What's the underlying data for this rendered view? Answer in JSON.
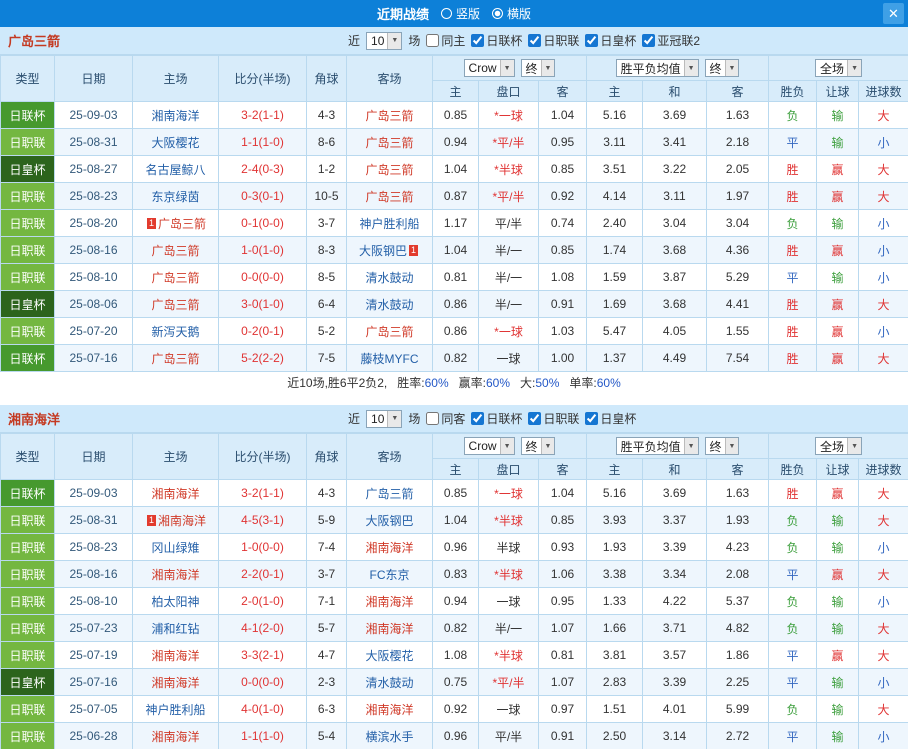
{
  "header": {
    "title": "近期战绩",
    "close_glyph": "✕",
    "layout_options": [
      {
        "label": "竖版",
        "selected": false
      },
      {
        "label": "横版",
        "selected": true
      }
    ]
  },
  "filter_labels": {
    "near": "近",
    "count": "10",
    "games": "场"
  },
  "table_header": {
    "cols": [
      "类型",
      "日期",
      "主场",
      "比分(半场)",
      "角球",
      "客场"
    ],
    "odds_group1": {
      "select1": "Crow",
      "select2": "终",
      "subcols": [
        "主",
        "盘口",
        "客"
      ]
    },
    "odds_group2": {
      "select1": "胜平负均值",
      "select2": "终",
      "subcols": [
        "主",
        "和",
        "客"
      ]
    },
    "result_group": {
      "select1": "全场",
      "subcols": [
        "胜负",
        "让球",
        "进球数"
      ]
    }
  },
  "sections": [
    {
      "team": "广岛三箭",
      "same_label": "同主",
      "same_checked": false,
      "leagues": [
        {
          "label": "日联杯",
          "checked": true
        },
        {
          "label": "日职联",
          "checked": true
        },
        {
          "label": "日皇杯",
          "checked": true
        },
        {
          "label": "亚冠联2",
          "checked": true
        }
      ],
      "rows": [
        {
          "type": "日联杯",
          "date": "25-09-03",
          "home": "湘南海洋",
          "score": "3-2(1-1)",
          "corner": "4-3",
          "away": "广岛三箭",
          "ah": [
            "0.85",
            "*一球",
            "1.04"
          ],
          "eu": [
            "5.16",
            "3.69",
            "1.63"
          ],
          "res": [
            "负",
            "输",
            "大"
          ]
        },
        {
          "type": "日职联",
          "date": "25-08-31",
          "home": "大阪樱花",
          "score": "1-1(1-0)",
          "corner": "8-6",
          "away": "广岛三箭",
          "ah": [
            "0.94",
            "*平/半",
            "0.95"
          ],
          "eu": [
            "3.11",
            "3.41",
            "2.18"
          ],
          "res": [
            "平",
            "输",
            "小"
          ]
        },
        {
          "type": "日皇杯",
          "date": "25-08-27",
          "home": "名古屋鲸八",
          "score": "2-4(0-3)",
          "corner": "1-2",
          "away": "广岛三箭",
          "ah": [
            "1.04",
            "*半球",
            "0.85"
          ],
          "eu": [
            "3.51",
            "3.22",
            "2.05"
          ],
          "res": [
            "胜",
            "赢",
            "大"
          ]
        },
        {
          "type": "日职联",
          "date": "25-08-23",
          "home": "东京绿茵",
          "score": "0-3(0-1)",
          "corner": "10-5",
          "away": "广岛三箭",
          "ah": [
            "0.87",
            "*平/半",
            "0.92"
          ],
          "eu": [
            "4.14",
            "3.11",
            "1.97"
          ],
          "res": [
            "胜",
            "赢",
            "大"
          ]
        },
        {
          "type": "日职联",
          "date": "25-08-20",
          "home": "广岛三箭",
          "home_badge": "1",
          "score": "0-1(0-0)",
          "corner": "3-7",
          "away": "神户胜利船",
          "ah": [
            "1.17",
            "平/半",
            "0.74"
          ],
          "eu": [
            "2.40",
            "3.04",
            "3.04"
          ],
          "res": [
            "负",
            "输",
            "小"
          ]
        },
        {
          "type": "日职联",
          "date": "25-08-16",
          "home": "广岛三箭",
          "score": "1-0(1-0)",
          "corner": "8-3",
          "away": "大阪钢巴",
          "away_badge": "1",
          "ah": [
            "1.04",
            "半/一",
            "0.85"
          ],
          "eu": [
            "1.74",
            "3.68",
            "4.36"
          ],
          "res": [
            "胜",
            "赢",
            "小"
          ]
        },
        {
          "type": "日职联",
          "date": "25-08-10",
          "home": "广岛三箭",
          "score": "0-0(0-0)",
          "corner": "8-5",
          "away": "清水鼓动",
          "ah": [
            "0.81",
            "半/一",
            "1.08"
          ],
          "eu": [
            "1.59",
            "3.87",
            "5.29"
          ],
          "res": [
            "平",
            "输",
            "小"
          ]
        },
        {
          "type": "日皇杯",
          "date": "25-08-06",
          "home": "广岛三箭",
          "score": "3-0(1-0)",
          "corner": "6-4",
          "away": "清水鼓动",
          "ah": [
            "0.86",
            "半/一",
            "0.91"
          ],
          "eu": [
            "1.69",
            "3.68",
            "4.41"
          ],
          "res": [
            "胜",
            "赢",
            "大"
          ]
        },
        {
          "type": "日职联",
          "date": "25-07-20",
          "home": "新泻天鹅",
          "score": "0-2(0-1)",
          "corner": "5-2",
          "away": "广岛三箭",
          "ah": [
            "0.86",
            "*一球",
            "1.03"
          ],
          "eu": [
            "5.47",
            "4.05",
            "1.55"
          ],
          "res": [
            "胜",
            "赢",
            "小"
          ]
        },
        {
          "type": "日联杯",
          "date": "25-07-16",
          "home": "广岛三箭",
          "score": "5-2(2-2)",
          "corner": "7-5",
          "away": "藤枝MYFC",
          "ah": [
            "0.82",
            "一球",
            "1.00"
          ],
          "eu": [
            "1.37",
            "4.49",
            "7.54"
          ],
          "res": [
            "胜",
            "赢",
            "大"
          ]
        }
      ],
      "summary": {
        "prefix": "近10场,胜6平2负2,",
        "stats": [
          {
            "label": "胜率:",
            "value": "60%"
          },
          {
            "label": "赢率:",
            "value": "60%"
          },
          {
            "label": "大:",
            "value": "50%"
          },
          {
            "label": "单率:",
            "value": "60%"
          }
        ]
      }
    },
    {
      "team": "湘南海洋",
      "same_label": "同客",
      "same_checked": false,
      "leagues": [
        {
          "label": "日联杯",
          "checked": true
        },
        {
          "label": "日职联",
          "checked": true
        },
        {
          "label": "日皇杯",
          "checked": true
        }
      ],
      "rows": [
        {
          "type": "日联杯",
          "date": "25-09-03",
          "home": "湘南海洋",
          "score": "3-2(1-1)",
          "corner": "4-3",
          "away": "广岛三箭",
          "ah": [
            "0.85",
            "*一球",
            "1.04"
          ],
          "eu": [
            "5.16",
            "3.69",
            "1.63"
          ],
          "res": [
            "胜",
            "赢",
            "大"
          ]
        },
        {
          "type": "日职联",
          "date": "25-08-31",
          "home": "湘南海洋",
          "home_badge": "1",
          "score": "4-5(3-1)",
          "corner": "5-9",
          "away": "大阪钢巴",
          "ah": [
            "1.04",
            "*半球",
            "0.85"
          ],
          "eu": [
            "3.93",
            "3.37",
            "1.93"
          ],
          "res": [
            "负",
            "输",
            "大"
          ]
        },
        {
          "type": "日职联",
          "date": "25-08-23",
          "home": "冈山绿雉",
          "score": "1-0(0-0)",
          "corner": "7-4",
          "away": "湘南海洋",
          "ah": [
            "0.96",
            "半球",
            "0.93"
          ],
          "eu": [
            "1.93",
            "3.39",
            "4.23"
          ],
          "res": [
            "负",
            "输",
            "小"
          ]
        },
        {
          "type": "日职联",
          "date": "25-08-16",
          "home": "湘南海洋",
          "score": "2-2(0-1)",
          "corner": "3-7",
          "away": "FC东京",
          "ah": [
            "0.83",
            "*半球",
            "1.06"
          ],
          "eu": [
            "3.38",
            "3.34",
            "2.08"
          ],
          "res": [
            "平",
            "赢",
            "大"
          ]
        },
        {
          "type": "日职联",
          "date": "25-08-10",
          "home": "柏太阳神",
          "score": "2-0(1-0)",
          "corner": "7-1",
          "away": "湘南海洋",
          "ah": [
            "0.94",
            "一球",
            "0.95"
          ],
          "eu": [
            "1.33",
            "4.22",
            "5.37"
          ],
          "res": [
            "负",
            "输",
            "小"
          ]
        },
        {
          "type": "日职联",
          "date": "25-07-23",
          "home": "浦和红钻",
          "score": "4-1(2-0)",
          "corner": "5-7",
          "away": "湘南海洋",
          "ah": [
            "0.82",
            "半/一",
            "1.07"
          ],
          "eu": [
            "1.66",
            "3.71",
            "4.82"
          ],
          "res": [
            "负",
            "输",
            "大"
          ]
        },
        {
          "type": "日职联",
          "date": "25-07-19",
          "home": "湘南海洋",
          "score": "3-3(2-1)",
          "corner": "4-7",
          "away": "大阪樱花",
          "ah": [
            "1.08",
            "*半球",
            "0.81"
          ],
          "eu": [
            "3.81",
            "3.57",
            "1.86"
          ],
          "res": [
            "平",
            "赢",
            "大"
          ]
        },
        {
          "type": "日皇杯",
          "date": "25-07-16",
          "home": "湘南海洋",
          "score": "0-0(0-0)",
          "corner": "2-3",
          "away": "清水鼓动",
          "ah": [
            "0.75",
            "*平/半",
            "1.07"
          ],
          "eu": [
            "2.83",
            "3.39",
            "2.25"
          ],
          "res": [
            "平",
            "输",
            "小"
          ]
        },
        {
          "type": "日职联",
          "date": "25-07-05",
          "home": "神户胜利船",
          "score": "4-0(1-0)",
          "corner": "6-3",
          "away": "湘南海洋",
          "ah": [
            "0.92",
            "一球",
            "0.97"
          ],
          "eu": [
            "1.51",
            "4.01",
            "5.99"
          ],
          "res": [
            "负",
            "输",
            "大"
          ]
        },
        {
          "type": "日职联",
          "date": "25-06-28",
          "home": "湘南海洋",
          "score": "1-1(1-0)",
          "corner": "5-4",
          "away": "横滨水手",
          "ah": [
            "0.96",
            "平/半",
            "0.91"
          ],
          "eu": [
            "2.50",
            "3.14",
            "2.72"
          ],
          "res": [
            "平",
            "输",
            "小"
          ]
        }
      ],
      "summary": null
    }
  ]
}
